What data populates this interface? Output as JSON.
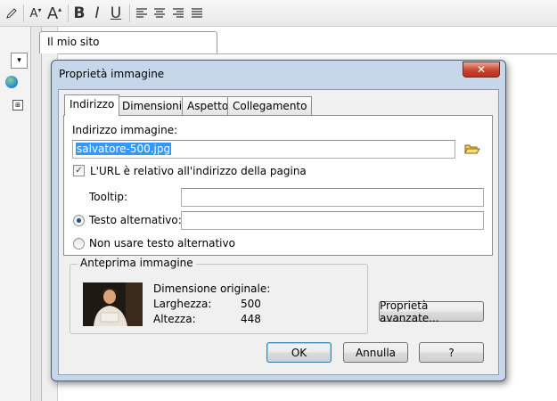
{
  "editor": {
    "site_tab": "Il mio sito",
    "left_dropdown_arrow": "▾",
    "toolbar": {
      "font_smaller": "A",
      "font_larger": "A",
      "bold": "B",
      "italic": "I",
      "underline": "U"
    }
  },
  "dialog": {
    "title": "Proprietà immagine",
    "close": "✕",
    "tabs": [
      {
        "label": "Indirizzo",
        "active": true
      },
      {
        "label": "Dimensioni",
        "active": false
      },
      {
        "label": "Aspetto",
        "active": false
      },
      {
        "label": "Collegamento",
        "active": false
      }
    ],
    "address_label": "Indirizzo immagine:",
    "address_value": "salvatore-500.jpg",
    "relative_url_label": "L'URL è relativo all'indirizzo della pagina",
    "relative_url_checked": true,
    "tooltip_label": "Tooltip:",
    "tooltip_value": "",
    "alt_text_label": "Testo alternativo:",
    "alt_text_value": "",
    "alt_text_selected": true,
    "no_alt_label": "Non usare testo alternativo",
    "preview": {
      "legend": "Anteprima immagine",
      "original_size_label": "Dimensione originale:",
      "width_label": "Larghezza:",
      "width_value": "500",
      "height_label": "Altezza:",
      "height_value": "448"
    },
    "advanced_button": "Proprietà avanzate...",
    "ok_button": "OK",
    "cancel_button": "Annulla",
    "help_button": "?"
  },
  "colors": {
    "dialog_frame": "#c7d7ea",
    "selection": "#3399ff",
    "close_button": "#c9452f"
  }
}
